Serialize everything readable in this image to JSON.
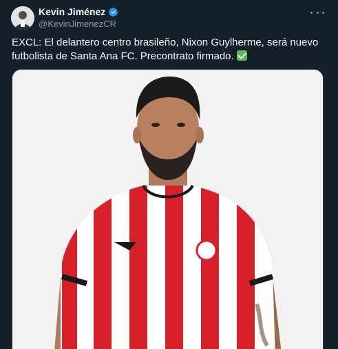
{
  "author": {
    "name": "Kevin Jiménez",
    "handle": "@KevinJimenezCR",
    "verified": true,
    "avatar_icon": "person-avatar"
  },
  "tweet": {
    "text": "EXCL: El delantero centro brasileño, Nixon Guylherme, será nuevo futbolista de Santa Ana FC. Precontrato firmado.",
    "emoji_icon": "check-mark-button"
  },
  "media": {
    "description_icon": "player-photo"
  },
  "colors": {
    "background": "#15202b",
    "text_primary": "#f7f9f9",
    "text_secondary": "#8b98a5",
    "verified_blue": "#1d9bf0",
    "jersey_red": "#d8202b"
  }
}
